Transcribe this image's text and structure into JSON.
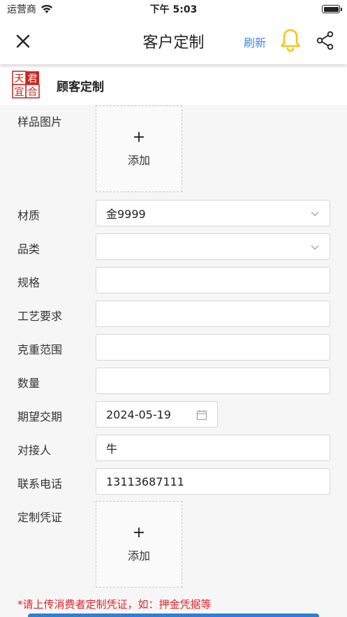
{
  "status": {
    "carrier": "运营商",
    "time": "下午 5:03"
  },
  "nav": {
    "title": "客户定制",
    "refresh": "刷新"
  },
  "brand": {
    "name": "顾客定制",
    "logo_chars": [
      "天",
      "君",
      "宜",
      "合"
    ]
  },
  "colors": {
    "accent": "#3a86e0",
    "bell": "#f5c518",
    "note": "#e0242b",
    "logo_red": "#c8261f"
  },
  "form": {
    "sample_image": {
      "label": "样品图片",
      "plus": "+",
      "add": "添加"
    },
    "material": {
      "label": "材质",
      "value": "金9999"
    },
    "category": {
      "label": "品类",
      "value": ""
    },
    "spec": {
      "label": "规格",
      "value": ""
    },
    "craft": {
      "label": "工艺要求",
      "value": ""
    },
    "weight_range": {
      "label": "克重范围",
      "value": ""
    },
    "quantity": {
      "label": "数量",
      "value": ""
    },
    "delivery_date": {
      "label": "期望交期",
      "value": "2024-05-19"
    },
    "contact": {
      "label": "对接人",
      "value": "牛"
    },
    "phone": {
      "label": "联系电话",
      "value": "13113687111"
    },
    "voucher": {
      "label": "定制凭证",
      "plus": "+",
      "add": "添加"
    },
    "note": "*请上传消费者定制凭证，如：押金凭据等"
  }
}
